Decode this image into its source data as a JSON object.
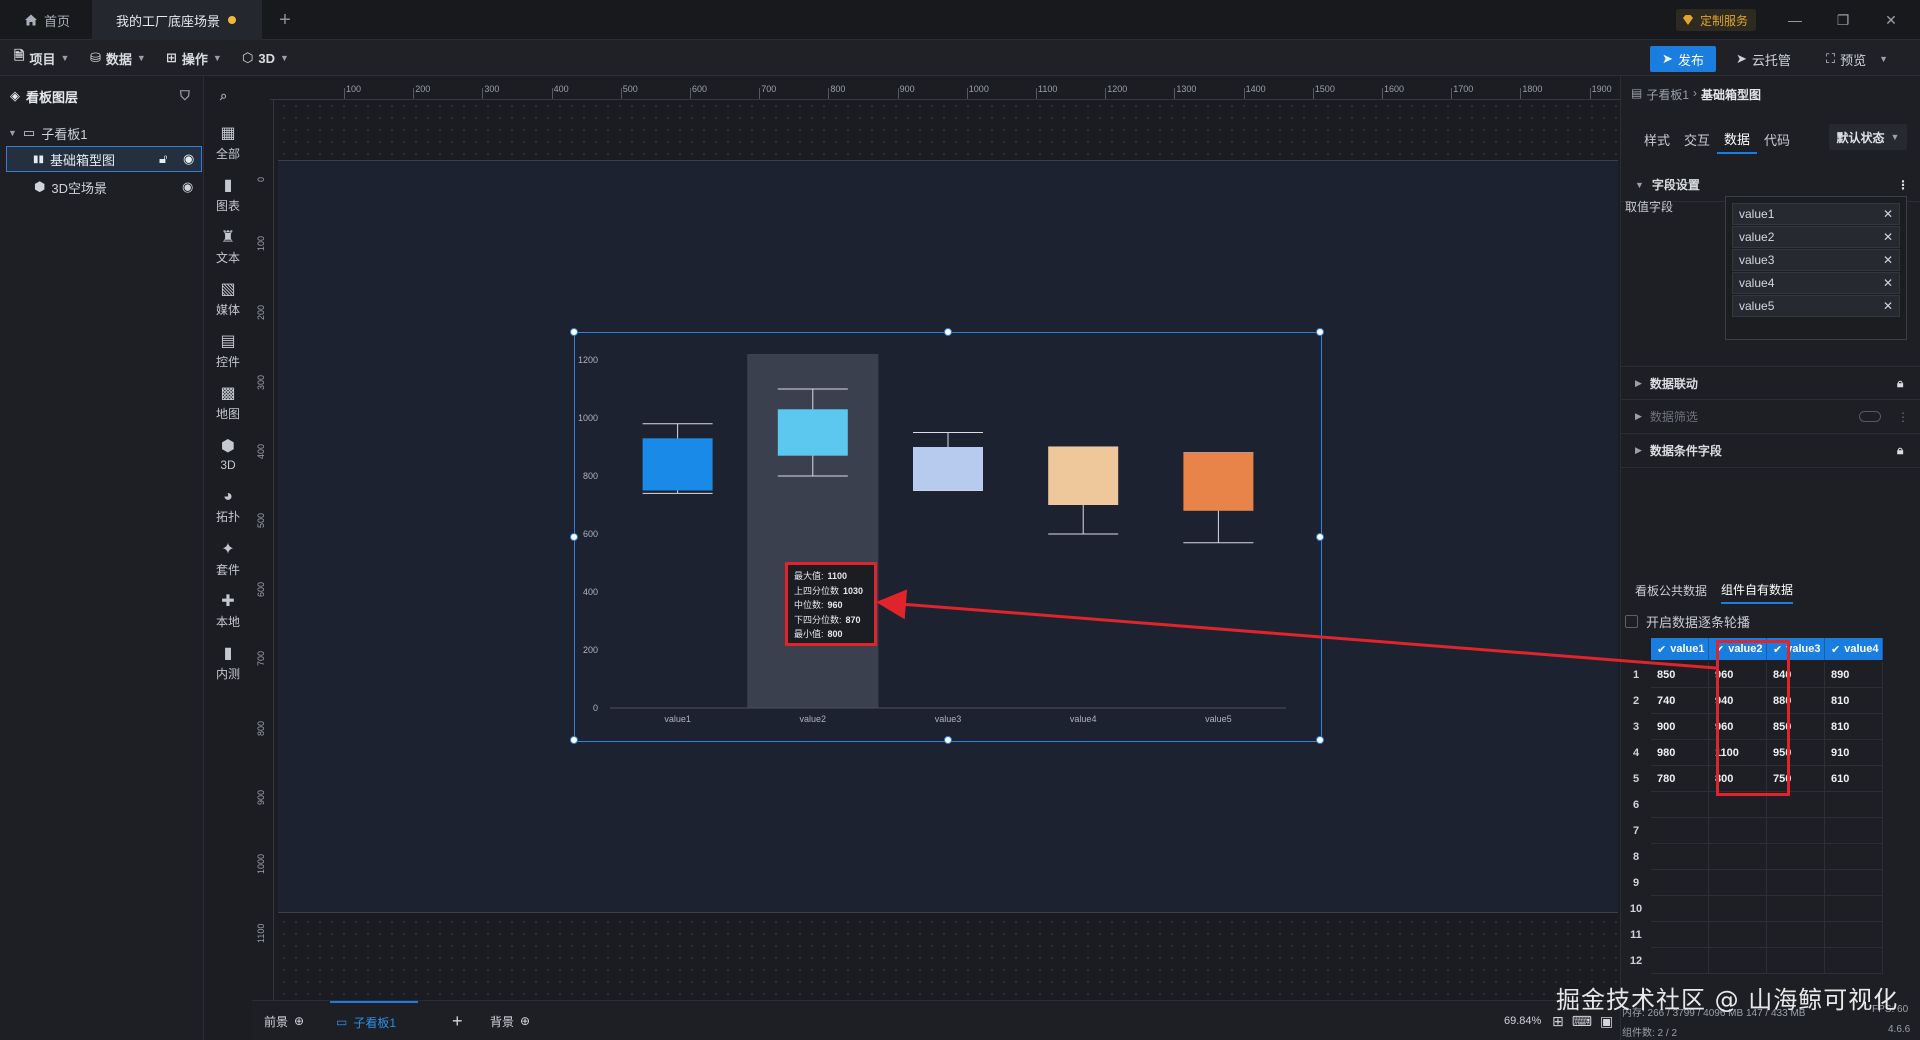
{
  "titlebar": {
    "tab_home": "首页",
    "tab_scene": "我的工厂底座场景",
    "tab_add": "+",
    "custom_service": "定制服务"
  },
  "menubar": {
    "project": "项目",
    "data": "数据",
    "operation": "操作",
    "three_d": "3D",
    "publish": "发布",
    "cloud_host": "云托管",
    "preview": "预览"
  },
  "layers": {
    "title": "看板图层",
    "board": "子看板1",
    "boxplot": "基础箱型图",
    "scene3d": "3D空场景"
  },
  "components": [
    "全部",
    "图表",
    "文本",
    "媒体",
    "控件",
    "地图",
    "3D",
    "拓扑",
    "套件",
    "本地",
    "内测"
  ],
  "ruler": {
    "top": [
      "100",
      "200",
      "300",
      "400",
      "500",
      "600",
      "700",
      "800",
      "900",
      "1000",
      "1100",
      "1200",
      "1300",
      "1400",
      "1500",
      "1600",
      "1700",
      "1800",
      "1900"
    ],
    "left": [
      "0",
      "100",
      "200",
      "300",
      "400",
      "500",
      "600",
      "700",
      "800",
      "900",
      "1000",
      "1100"
    ]
  },
  "chart_data": {
    "type": "boxplot",
    "categories": [
      "value1",
      "value2",
      "value3",
      "value4",
      "value5"
    ],
    "y_ticks": [
      "0",
      "200",
      "400",
      "600",
      "800",
      "1000",
      "1200"
    ],
    "ylim": [
      0,
      1200
    ],
    "boxes": [
      {
        "min": 740,
        "q1": 750,
        "median": 850,
        "q3": 930,
        "max": 980,
        "color": "#1a8ae8"
      },
      {
        "min": 800,
        "q1": 870,
        "median": 960,
        "q3": 1030,
        "max": 1100,
        "color": "#5cc8ef"
      },
      {
        "min": 750,
        "q1": 750,
        "median": 850,
        "q3": 900,
        "max": 950,
        "color": "#b7cbee"
      },
      {
        "min": 600,
        "q1": 700,
        "median": 810,
        "q3": 900,
        "max": 900,
        "color": "#eec89b"
      },
      {
        "min": 570,
        "q1": 680,
        "median": 800,
        "q3": 880,
        "max": 880,
        "color": "#e8844a"
      }
    ],
    "highlight_index": 1
  },
  "tooltip": {
    "rows": [
      {
        "label": "最大值:",
        "value": "1100"
      },
      {
        "label": "上四分位数",
        "value": "1030"
      },
      {
        "label": "中位数:",
        "value": "960"
      },
      {
        "label": "下四分位数:",
        "value": "870"
      },
      {
        "label": "最小值:",
        "value": "800"
      }
    ]
  },
  "right_panel": {
    "breadcrumb_parent": "子看板1",
    "breadcrumb_current": "基础箱型图",
    "tabs": [
      "样式",
      "交互",
      "数据",
      "代码"
    ],
    "active_tab": "数据",
    "state": "默认状态",
    "section_field": "字段设置",
    "field_label": "取值字段",
    "fields": [
      "value1",
      "value2",
      "value3",
      "value4",
      "value5"
    ],
    "section_link": "数据联动",
    "section_filter": "数据筛选",
    "section_condition": "数据条件字段",
    "data_tabs": [
      "看板公共数据",
      "组件自有数据"
    ],
    "carousel": "开启数据逐条轮播"
  },
  "grid": {
    "headers": [
      "value1",
      "value2",
      "value3",
      "value4"
    ],
    "rows": [
      [
        "850",
        "960",
        "840",
        "890"
      ],
      [
        "740",
        "940",
        "880",
        "810"
      ],
      [
        "900",
        "960",
        "850",
        "810"
      ],
      [
        "980",
        "1100",
        "950",
        "910"
      ],
      [
        "780",
        "800",
        "750",
        "610"
      ]
    ],
    "row_numbers": [
      "1",
      "2",
      "3",
      "4",
      "5",
      "6",
      "7",
      "8",
      "9",
      "10",
      "11",
      "12"
    ]
  },
  "bottombar": {
    "foreground": "前景",
    "board": "子看板1",
    "add": "+",
    "background": "背景",
    "zoom": "69.84%"
  },
  "status": {
    "memory": "内存: 266 / 3799 / 4096 MB  147 / 433 MB",
    "fps": "FPS: 60",
    "components": "组件数: 2 / 2",
    "version": "4.6.6"
  },
  "watermark": "掘金技术社区 @ 山海鲸可视化",
  "colors": {
    "accent": "#1a7de0",
    "highlight": "#e0242b",
    "warning": "#f0b93a"
  }
}
